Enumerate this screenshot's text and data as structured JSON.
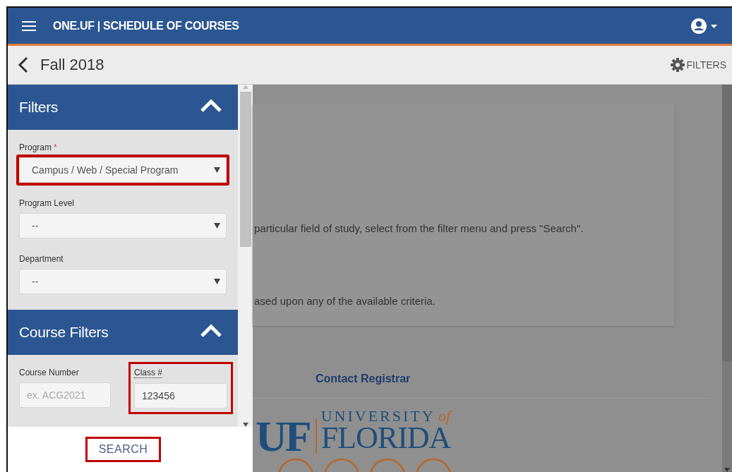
{
  "header": {
    "title": "ONE.UF | SCHEDULE OF COURSES"
  },
  "subheader": {
    "term": "Fall 2018",
    "filters_button": "FILTERS"
  },
  "filter_sections": [
    {
      "title": "Filters",
      "expanded": true,
      "fields": [
        {
          "kind": "select",
          "label": "Program",
          "required_mark": "*",
          "value": "Campus / Web / Special Program",
          "highlighted": true
        },
        {
          "kind": "select",
          "label": "Program Level",
          "value": "--",
          "highlighted": false
        },
        {
          "kind": "select",
          "label": "Department",
          "value": "--",
          "highlighted": false
        }
      ]
    },
    {
      "title": "Course Filters",
      "expanded": true,
      "fields": [
        {
          "kind": "text",
          "label": "Course Number",
          "placeholder": "ex. ACG2021",
          "highlighted": false
        },
        {
          "kind": "text",
          "label": "Class #",
          "value": "123456",
          "highlighted": true
        }
      ]
    }
  ],
  "search_button": {
    "label": "SEARCH",
    "highlighted": true
  },
  "content": {
    "paragraphs": [
      "particular field of study, select from the filter menu and press \"Search\".",
      "ased upon any of the available criteria."
    ]
  },
  "footer": {
    "link": "Contact Registrar",
    "logo": {
      "mark": "UF",
      "line1": "UNIVERSITY",
      "line1_suffix": "of",
      "line2": "FLORIDA"
    }
  }
}
